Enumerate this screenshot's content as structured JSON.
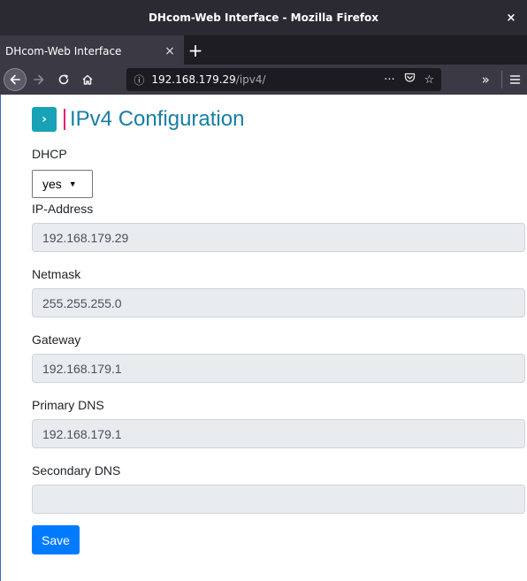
{
  "window": {
    "title": "DHcom-Web Interface - Mozilla Firefox",
    "close_glyph": "×"
  },
  "tabs": {
    "active_label": "DHcom-Web Interface",
    "close_glyph": "×",
    "new_tab_glyph": "+"
  },
  "navbar": {
    "url_host": "192.168.179.29",
    "url_path": "/ipv4/",
    "icons": [
      "back-arrow-icon",
      "forward-arrow-icon",
      "reload-icon",
      "home-icon",
      "info-icon",
      "more-icon",
      "pocket-icon",
      "bookmark-star-icon",
      "overflow-chevron-icon",
      "hamburger-menu-icon"
    ]
  },
  "page": {
    "heading_badge": "›",
    "title": "IPv4 Configuration",
    "dhcp": {
      "label": "DHCP",
      "value": "yes"
    },
    "fields": [
      {
        "label": "IP-Address",
        "value": "192.168.179.29"
      },
      {
        "label": "Netmask",
        "value": "255.255.255.0"
      },
      {
        "label": "Gateway",
        "value": "192.168.179.1"
      },
      {
        "label": "Primary DNS",
        "value": "192.168.179.1"
      },
      {
        "label": "Secondary DNS",
        "value": ""
      }
    ],
    "save_label": "Save"
  },
  "colors": {
    "accent_teal": "#17a2b8",
    "title_blue": "#177ea5",
    "title_bar_pink": "#e6197a",
    "primary_button": "#007bff"
  }
}
